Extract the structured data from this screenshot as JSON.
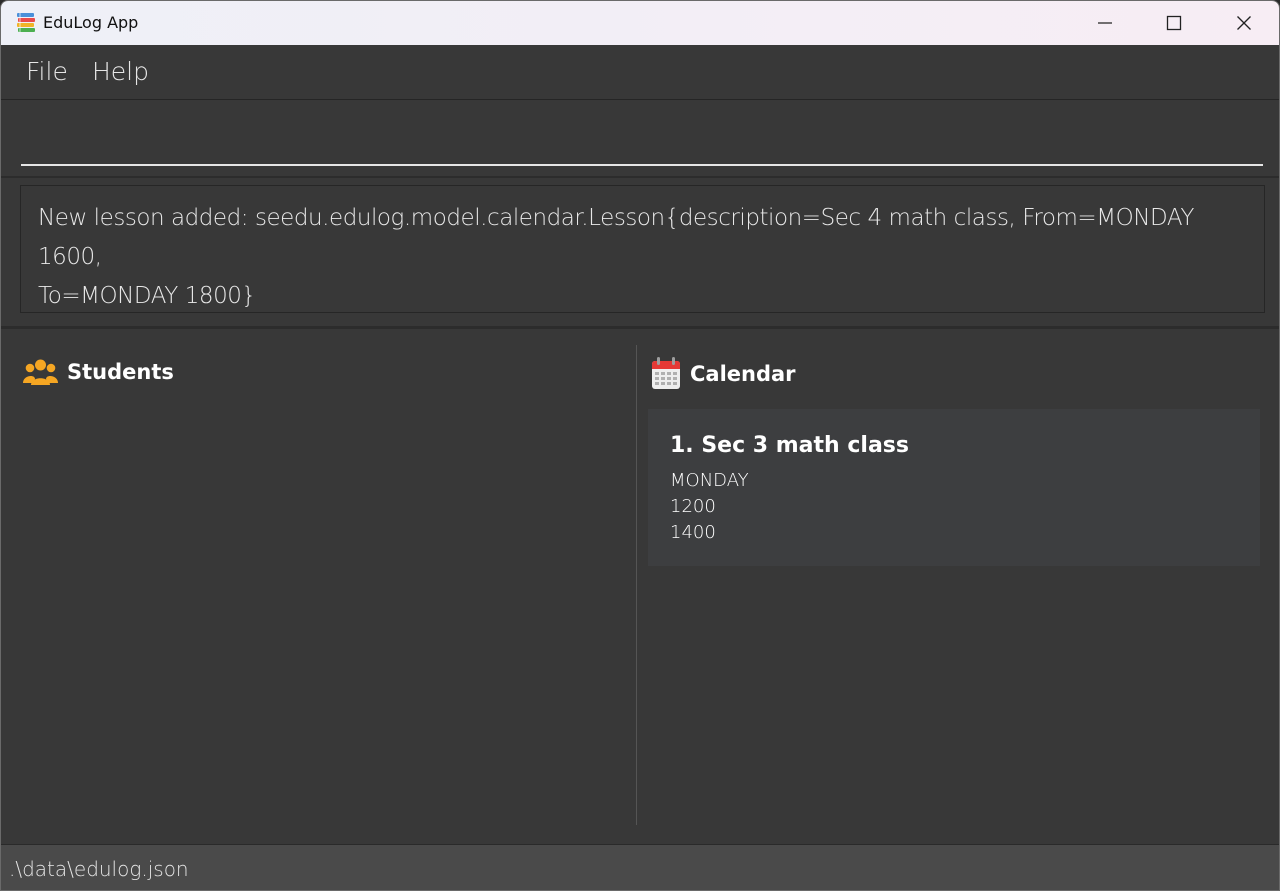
{
  "window": {
    "title": "EduLog App"
  },
  "menu": {
    "file_label": "File",
    "help_label": "Help"
  },
  "command": {
    "value": ""
  },
  "result": {
    "line1": "New lesson added: seedu.edulog.model.calendar.Lesson{description=Sec 4 math class, From=MONDAY 1600,",
    "line2": "To=MONDAY 1800}"
  },
  "students": {
    "title": "Students",
    "icon": "people-icon",
    "icon_color": "#f5a623"
  },
  "calendar": {
    "title": "Calendar",
    "icon": "calendar-icon",
    "lessons": [
      {
        "title": "1. Sec 3 math class",
        "day": "MONDAY",
        "start": "1200",
        "end": "1400"
      }
    ]
  },
  "status": {
    "path": ".\\data\\edulog.json"
  },
  "colors": {
    "background": "#383838",
    "card": "#3d3e40",
    "statusbar": "#4a4a4a",
    "text": "#e6e6e6"
  }
}
